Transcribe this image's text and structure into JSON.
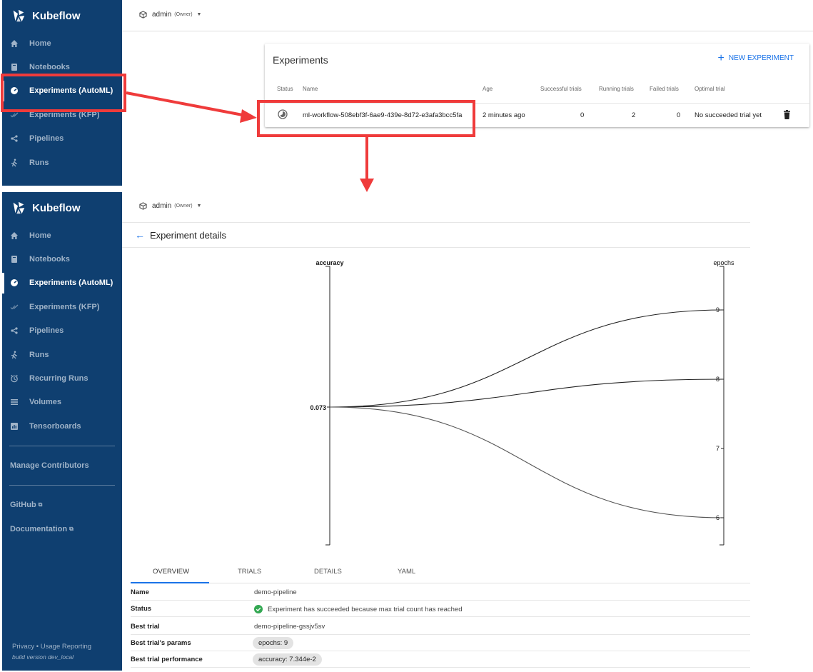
{
  "app": {
    "name": "Kubeflow"
  },
  "sidebar_top": {
    "items": [
      {
        "label": "Home",
        "icon": "home-icon"
      },
      {
        "label": "Notebooks",
        "icon": "notebook-icon"
      },
      {
        "label": "Experiments (AutoML)",
        "icon": "automl-icon",
        "active": true
      },
      {
        "label": "Experiments (KFP)",
        "icon": "done-all-icon"
      },
      {
        "label": "Pipelines",
        "icon": "pipelines-icon"
      },
      {
        "label": "Runs",
        "icon": "runs-icon"
      }
    ]
  },
  "sidebar_bottom": {
    "items": [
      {
        "label": "Home",
        "icon": "home-icon"
      },
      {
        "label": "Notebooks",
        "icon": "notebook-icon"
      },
      {
        "label": "Experiments (AutoML)",
        "icon": "automl-icon",
        "active": true
      },
      {
        "label": "Experiments (KFP)",
        "icon": "done-all-icon"
      },
      {
        "label": "Pipelines",
        "icon": "pipelines-icon"
      },
      {
        "label": "Runs",
        "icon": "runs-icon"
      },
      {
        "label": "Recurring Runs",
        "icon": "alarm-icon"
      },
      {
        "label": "Volumes",
        "icon": "volumes-icon"
      },
      {
        "label": "Tensorboards",
        "icon": "tensorboards-icon"
      }
    ],
    "manage_contributors": "Manage Contributors",
    "github": "GitHub",
    "documentation": "Documentation",
    "privacy": "Privacy",
    "usage_reporting": "Usage Reporting",
    "build_version": "build version dev_local"
  },
  "namespace": {
    "name": "admin",
    "role": "(Owner)"
  },
  "experiments_card": {
    "title": "Experiments",
    "new_button": "NEW EXPERIMENT",
    "columns": [
      "Status",
      "Name",
      "Age",
      "Successful trials",
      "Running trials",
      "Failed trials",
      "Optimal trial"
    ],
    "row": {
      "name": "ml-workflow-508ebf3f-6ae9-439e-8d72-e3afa3bcc5fa",
      "age": "2 minutes ago",
      "successful": "0",
      "running": "2",
      "failed": "0",
      "optimal": "No succeeded trial yet"
    }
  },
  "details": {
    "title": "Experiment details",
    "tabs": [
      "OVERVIEW",
      "TRIALS",
      "DETAILS",
      "YAML"
    ],
    "overview": {
      "name_label": "Name",
      "name_value": "demo-pipeline",
      "status_label": "Status",
      "status_value": "Experiment has succeeded because max trial count has reached",
      "best_trial_label": "Best trial",
      "best_trial_value": "demo-pipeline-gssjv5sv",
      "params_label": "Best trial's params",
      "params_value": "epochs: 9",
      "performance_label": "Best trial performance",
      "performance_value": "accuracy: 7.344e-2"
    }
  },
  "colors": {
    "sidebar": "#0f3f70",
    "accent": "#1a73e8",
    "annotation": "#ef3b3b",
    "success": "#34a853"
  },
  "chart_data": {
    "type": "parallel-coordinates",
    "axes": [
      {
        "name": "accuracy",
        "ticks": [
          "0.073"
        ]
      },
      {
        "name": "epochs",
        "ticks": [
          "6",
          "7",
          "8",
          "9"
        ],
        "range": [
          6,
          9
        ]
      }
    ],
    "lines": [
      {
        "accuracy": 0.073,
        "epochs": 9
      },
      {
        "accuracy": 0.073,
        "epochs": 8
      },
      {
        "accuracy": 0.073,
        "epochs": 6
      }
    ]
  }
}
